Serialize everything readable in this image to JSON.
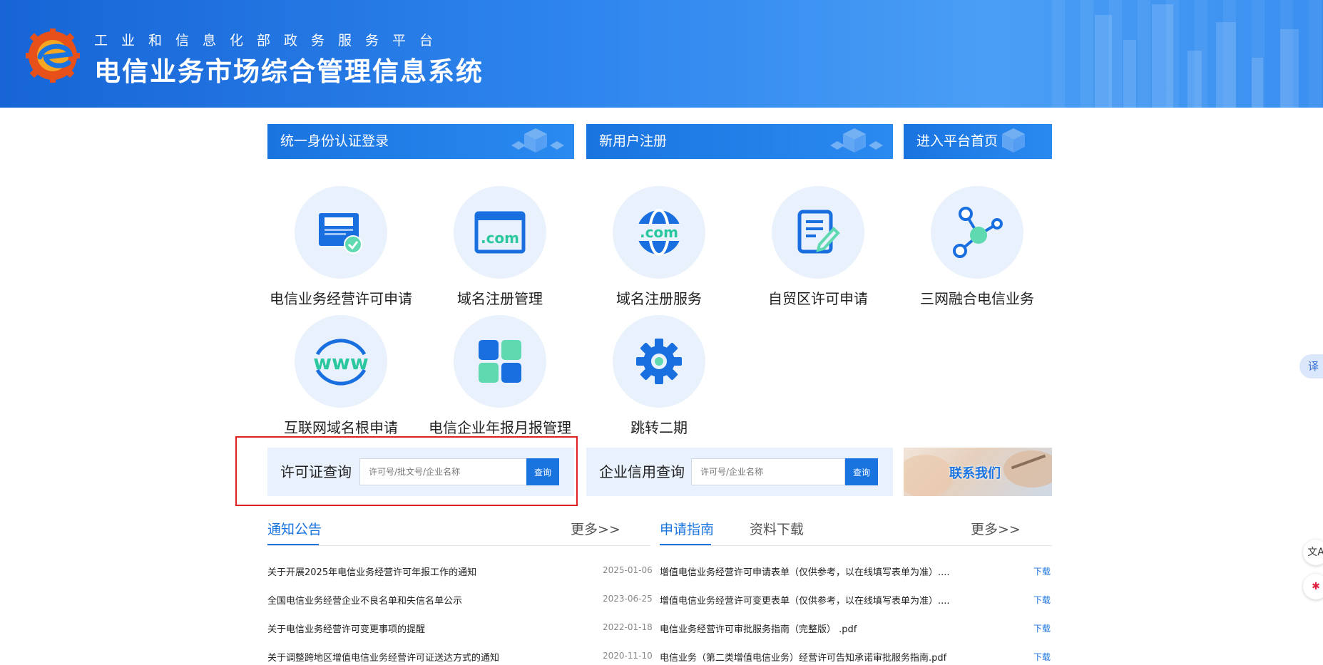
{
  "header": {
    "subtitle": "工业和信息化部政务服务平台",
    "title": "电信业务市场综合管理信息系统"
  },
  "entries": {
    "login": "统一身份认证登录",
    "register": "新用户注册",
    "home": "进入平台首页"
  },
  "services": [
    {
      "label": "电信业务经营许可申请",
      "icon": "license-card-icon"
    },
    {
      "label": "域名注册管理",
      "icon": "dotcom-window-icon"
    },
    {
      "label": "域名注册服务",
      "icon": "globe-dotcom-icon"
    },
    {
      "label": "自贸区许可申请",
      "icon": "document-edit-icon"
    },
    {
      "label": "三网融合电信业务",
      "icon": "network-nodes-icon"
    },
    {
      "label": "互联网域名根申请",
      "icon": "www-icon"
    },
    {
      "label": "电信企业年报月报管理",
      "icon": "tiles-grid-icon"
    },
    {
      "label": "跳转二期",
      "icon": "gear-icon"
    }
  ],
  "license_query": {
    "label": "许可证查询",
    "placeholder": "许可号/批文号/企业名称",
    "button": "查询"
  },
  "credit_query": {
    "label": "企业信用查询",
    "placeholder": "许可号/企业名称",
    "button": "查询"
  },
  "contact": {
    "label": "联系我们"
  },
  "notice": {
    "tab": "通知公告",
    "more": "更多>>",
    "items": [
      {
        "title": "关于开展2025年电信业务经营许可年报工作的通知",
        "date": "2025-01-06"
      },
      {
        "title": "全国电信业务经营企业不良名单和失信名单公示",
        "date": "2023-06-25"
      },
      {
        "title": "关于电信业务经营许可变更事项的提醒",
        "date": "2022-01-18"
      },
      {
        "title": "关于调整跨地区增值电信业务经营许可证送达方式的通知",
        "date": "2020-11-10"
      }
    ]
  },
  "guide": {
    "tab_active": "申请指南",
    "tab_other": "资料下载",
    "more": "更多>>",
    "download_label": "下载",
    "items": [
      {
        "title": "增值电信业务经营许可申请表单（仅供参考，以在线填写表单为准）...."
      },
      {
        "title": "增值电信业务经营许可变更表单（仅供参考，以在线填写表单为准）...."
      },
      {
        "title": "电信业务经营许可审批服务指南（完整版） .pdf"
      },
      {
        "title": "电信业务（第二类增值电信业务）经营许可告知承诺审批服务指南.pdf"
      }
    ]
  },
  "side": {
    "translate": "译",
    "btn1": "文A",
    "btn2": "✱"
  },
  "colors": {
    "primary": "#1a74e0",
    "circle": "#e8f1fc",
    "accent_green": "#5ed9b0",
    "highlight": "#e02020"
  }
}
